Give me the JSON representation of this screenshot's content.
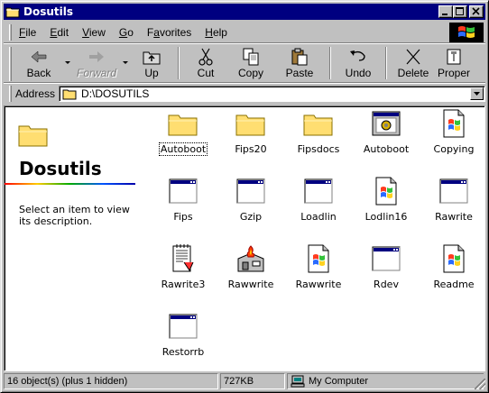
{
  "window": {
    "title": "Dosutils"
  },
  "menu": [
    {
      "label": "File",
      "u": "F",
      "rest": "ile"
    },
    {
      "label": "Edit",
      "u": "E",
      "rest": "dit"
    },
    {
      "label": "View",
      "u": "V",
      "rest": "iew"
    },
    {
      "label": "Go",
      "u": "G",
      "rest": "o"
    },
    {
      "label": "Favorites",
      "u": "a",
      "pre": "F",
      "rest": "vorites"
    },
    {
      "label": "Help",
      "u": "H",
      "rest": "elp"
    }
  ],
  "toolbar": {
    "back": "Back",
    "forward": "Forward",
    "up": "Up",
    "cut": "Cut",
    "copy": "Copy",
    "paste": "Paste",
    "undo": "Undo",
    "delete": "Delete",
    "properties": "Proper"
  },
  "address": {
    "label": "Address",
    "value": "D:\\DOSUTILS"
  },
  "left_pane": {
    "title": "Dosutils",
    "description": "Select an item to view its description."
  },
  "items": [
    {
      "label": "Autoboot",
      "icon": "folder-icon"
    },
    {
      "label": "Fips20",
      "icon": "folder-icon"
    },
    {
      "label": "Fipsdocs",
      "icon": "folder-icon"
    },
    {
      "label": "Autoboot",
      "icon": "msdos-program-icon"
    },
    {
      "label": "Copying",
      "icon": "windows-document-icon"
    },
    {
      "label": "Fips",
      "icon": "application-window-icon"
    },
    {
      "label": "Gzip",
      "icon": "application-window-icon"
    },
    {
      "label": "Loadlin",
      "icon": "application-window-icon"
    },
    {
      "label": "Lodlin16",
      "icon": "windows-document-icon"
    },
    {
      "label": "Rawrite",
      "icon": "application-window-icon"
    },
    {
      "label": "Rawrite3",
      "icon": "text-document-icon"
    },
    {
      "label": "Rawwrite",
      "icon": "setup-installer-icon"
    },
    {
      "label": "Rawwrite",
      "icon": "windows-document-icon"
    },
    {
      "label": "Rdev",
      "icon": "application-window-icon"
    },
    {
      "label": "Readme",
      "icon": "windows-document-icon"
    },
    {
      "label": "Restorrb",
      "icon": "application-window-icon"
    }
  ],
  "status": {
    "objects": "16 object(s) (plus 1 hidden)",
    "size": "727KB",
    "location": "My Computer"
  },
  "colors": {
    "titlebar": "#000080",
    "face": "#c0c0c0"
  }
}
